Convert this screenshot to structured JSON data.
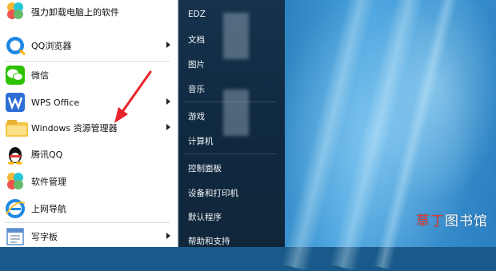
{
  "left_menu": {
    "items": [
      {
        "label": "强力卸载电脑上的软件",
        "icon": "uninstaller-icon",
        "has_arrow": false
      },
      {
        "label": "QQ浏览器",
        "icon": "qq-browser-icon",
        "has_arrow": true
      },
      {
        "label": "微信",
        "icon": "wechat-icon",
        "has_arrow": false
      },
      {
        "label": "WPS Office",
        "icon": "wps-office-icon",
        "has_arrow": true
      },
      {
        "label": "Windows 资源管理器",
        "icon": "explorer-folder-icon",
        "has_arrow": true
      },
      {
        "label": "腾讯QQ",
        "icon": "qq-penguin-icon",
        "has_arrow": false
      },
      {
        "label": "软件管理",
        "icon": "software-manager-icon",
        "has_arrow": false
      },
      {
        "label": "上网导航",
        "icon": "ie-navigation-icon",
        "has_arrow": false
      },
      {
        "label": "写字板",
        "icon": "wordpad-icon",
        "has_arrow": true
      }
    ]
  },
  "right_menu": {
    "items": [
      "EDZ",
      "文档",
      "图片",
      "音乐",
      "游戏",
      "计算机",
      "控制面板",
      "设备和打印机",
      "默认程序",
      "帮助和支持"
    ]
  },
  "watermark": {
    "part1": "草丁",
    "part2": "图书馆"
  },
  "colors": {
    "annotation_arrow": "#e8242b",
    "right_pane": "#12304a"
  }
}
